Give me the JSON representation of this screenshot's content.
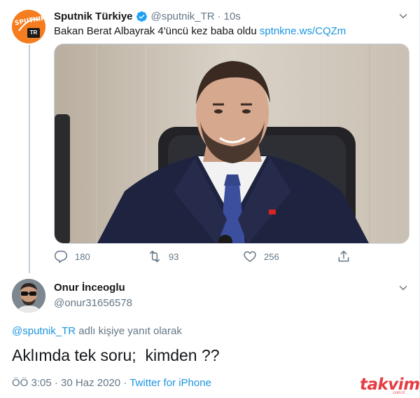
{
  "tweet": {
    "author_name": "Sputnik Türkiye",
    "author_handle": "@sputnik_TR",
    "separator": "·",
    "time_ago": "10s",
    "text": "Bakan Berat Albayrak 4'üncü kez baba oldu",
    "link_text": "sptnkne.ws/CQZm",
    "avatar_logo_text": "SPUTNIK",
    "avatar_badge": "TR",
    "stats": {
      "replies": "180",
      "retweets": "93",
      "likes": "256"
    }
  },
  "reply": {
    "author_name": "Onur İnceoglu",
    "author_handle": "@onur31656578",
    "reply_to_handle": "@sputnik_TR",
    "reply_to_suffix": " adlı kişiye yanıt olarak",
    "text": "Aklımda tek soru;  kimden ??",
    "time": "ÖÖ 3:05",
    "meta_sep": " · ",
    "date": "30 Haz 2020",
    "source": "Twitter for iPhone"
  },
  "watermark": {
    "brand": "takvim",
    "sub": ".com.tr"
  },
  "colors": {
    "accent": "#1b95e0",
    "text": "#14171a",
    "muted": "#657786",
    "sputnik_orange": "#f57c1f",
    "watermark_red": "#e21b23"
  },
  "icons": {
    "verified": "verified-badge-icon",
    "caret": "chevron-down-icon",
    "reply": "reply-icon",
    "retweet": "retweet-icon",
    "like": "heart-icon",
    "share": "share-icon"
  }
}
